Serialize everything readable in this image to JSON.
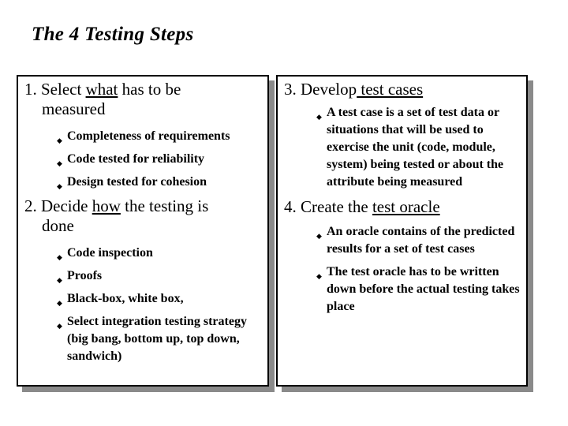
{
  "slide": {
    "title": "The 4 Testing Steps",
    "left_box": {
      "step1": {
        "number": "1.",
        "prefix": "Select ",
        "underlined": "what",
        "suffix": " has to be",
        "continuation": "measured",
        "bullets": [
          "Completeness of requirements",
          "Code tested for reliability",
          "Design tested for cohesion"
        ]
      },
      "step2": {
        "number": "2.",
        "prefix": "Decide ",
        "underlined": "how",
        "suffix": " the testing is",
        "continuation": "done",
        "bullets": [
          "Code inspection",
          "Proofs",
          "Black-box, white box,",
          "Select integration testing strategy (big bang, bottom up, top down, sandwich)"
        ]
      }
    },
    "right_box": {
      "step3": {
        "number": "3.",
        "prefix": "Develop",
        "underlined": " test cases",
        "bullets": [
          "A test case is a set of test data or situations that will be used to exercise the unit (code, module, system) being tested or about the attribute being measured"
        ]
      },
      "step4": {
        "number": "4.",
        "prefix": "Create the ",
        "underlined": "test oracle",
        "bullets": [
          "An oracle contains of the predicted results for a set of test cases",
          "The test oracle has to be written down before the actual testing takes place"
        ]
      }
    },
    "bullet_glyph": "◆",
    "colors": {
      "background": "#ffffff",
      "border": "#000000",
      "shadow": "#8a8a8a"
    }
  }
}
